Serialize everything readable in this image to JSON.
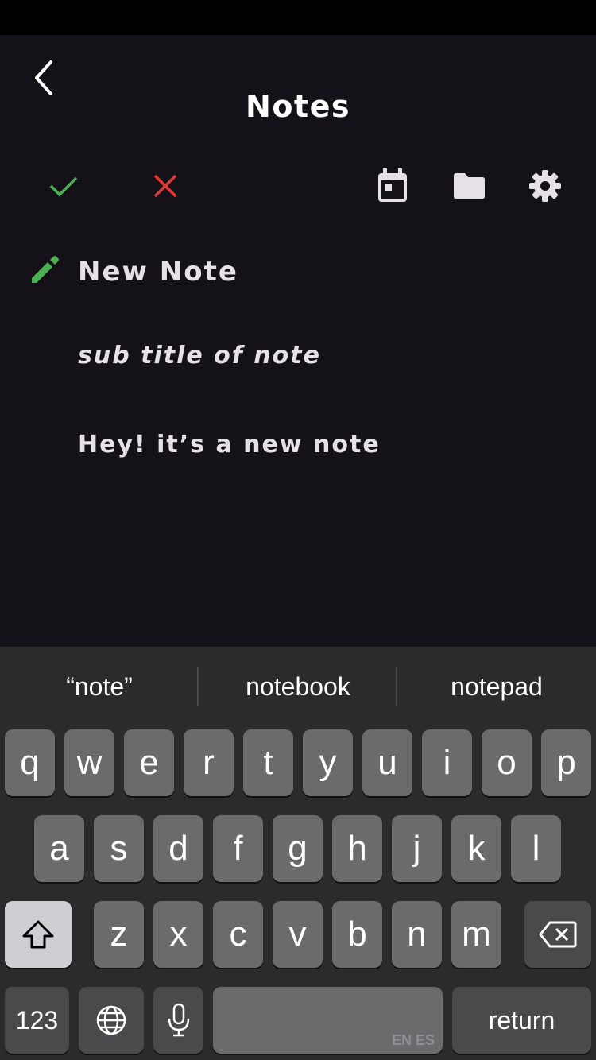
{
  "header": {
    "title": "Notes",
    "back_icon": "chevron-left-icon"
  },
  "toolbar": {
    "confirm_icon": "check-icon",
    "cancel_icon": "close-icon",
    "calendar_icon": "calendar-icon",
    "folder_icon": "folder-icon",
    "settings_icon": "gear-icon"
  },
  "note": {
    "edit_icon": "pencil-icon",
    "title": "New Note",
    "subtitle": "sub title of note",
    "body": "Hey! it’s a new note"
  },
  "keyboard": {
    "suggestions": [
      "“note”",
      "notebook",
      "notepad"
    ],
    "row1": [
      "q",
      "w",
      "e",
      "r",
      "t",
      "y",
      "u",
      "i",
      "o",
      "p"
    ],
    "row2": [
      "a",
      "s",
      "d",
      "f",
      "g",
      "h",
      "j",
      "k",
      "l"
    ],
    "row3": [
      "z",
      "x",
      "c",
      "v",
      "b",
      "n",
      "m"
    ],
    "numbers_label": "123",
    "space_languages": "EN ES",
    "return_label": "return"
  },
  "colors": {
    "background": "#141218",
    "accent_green": "#4caf50",
    "accent_red": "#e53935",
    "text": "#e6e0e9"
  }
}
